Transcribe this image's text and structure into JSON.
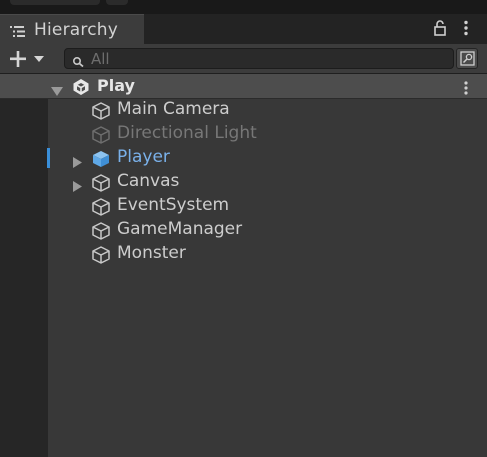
{
  "window": {
    "tab_label": "Hierarchy"
  },
  "toolbar": {
    "search_placeholder": "All"
  },
  "scene": {
    "name": "Play"
  },
  "objects": [
    {
      "label": "Main Camera",
      "expandable": false,
      "state": "normal"
    },
    {
      "label": "Directional Light",
      "expandable": false,
      "state": "disabled"
    },
    {
      "label": "Player",
      "expandable": true,
      "state": "selected"
    },
    {
      "label": "Canvas",
      "expandable": true,
      "state": "normal"
    },
    {
      "label": "EventSystem",
      "expandable": false,
      "state": "normal"
    },
    {
      "label": "GameManager",
      "expandable": false,
      "state": "normal"
    },
    {
      "label": "Monster",
      "expandable": false,
      "state": "normal"
    }
  ],
  "colors": {
    "selected_text": "#7ab1ea",
    "selection_marker": "#3a8fd9",
    "player_cube": "#5fa8e6",
    "disabled_text": "#777777"
  }
}
